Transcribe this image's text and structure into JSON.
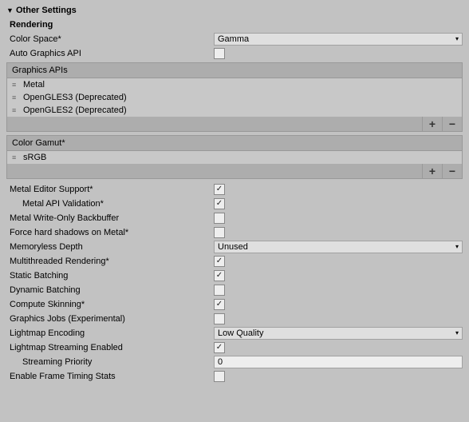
{
  "section_title": "Other Settings",
  "rendering_header": "Rendering",
  "labels": {
    "color_space": "Color Space*",
    "auto_graphics_api": "Auto Graphics API",
    "graphics_apis": "Graphics APIs",
    "color_gamut": "Color Gamut*",
    "metal_editor_support": "Metal Editor Support*",
    "metal_api_validation": "Metal API Validation*",
    "metal_write_only_bb": "Metal Write-Only Backbuffer",
    "force_hard_shadows": "Force hard shadows on Metal*",
    "memoryless_depth": "Memoryless Depth",
    "multithreaded_rendering": "Multithreaded Rendering*",
    "static_batching": "Static Batching",
    "dynamic_batching": "Dynamic Batching",
    "compute_skinning": "Compute Skinning*",
    "graphics_jobs": "Graphics Jobs (Experimental)",
    "lightmap_encoding": "Lightmap Encoding",
    "lightmap_streaming": "Lightmap Streaming Enabled",
    "streaming_priority": "Streaming Priority",
    "frame_timing_stats": "Enable Frame Timing Stats"
  },
  "values": {
    "color_space": "Gamma",
    "auto_graphics_api": false,
    "metal_editor_support": true,
    "metal_api_validation": true,
    "metal_write_only_bb": false,
    "force_hard_shadows": false,
    "memoryless_depth": "Unused",
    "multithreaded_rendering": true,
    "static_batching": true,
    "dynamic_batching": false,
    "compute_skinning": true,
    "graphics_jobs": false,
    "lightmap_encoding": "Low Quality",
    "lightmap_streaming": true,
    "streaming_priority": "0",
    "frame_timing_stats": false
  },
  "graphics_api_list": [
    "Metal",
    "OpenGLES3 (Deprecated)",
    "OpenGLES2 (Deprecated)"
  ],
  "color_gamut_list": [
    "sRGB"
  ],
  "icons": {
    "foldout_open": "▼",
    "dropdown_arrow": "▾",
    "drag_handle": "≡",
    "plus": "+",
    "minus": "−"
  }
}
